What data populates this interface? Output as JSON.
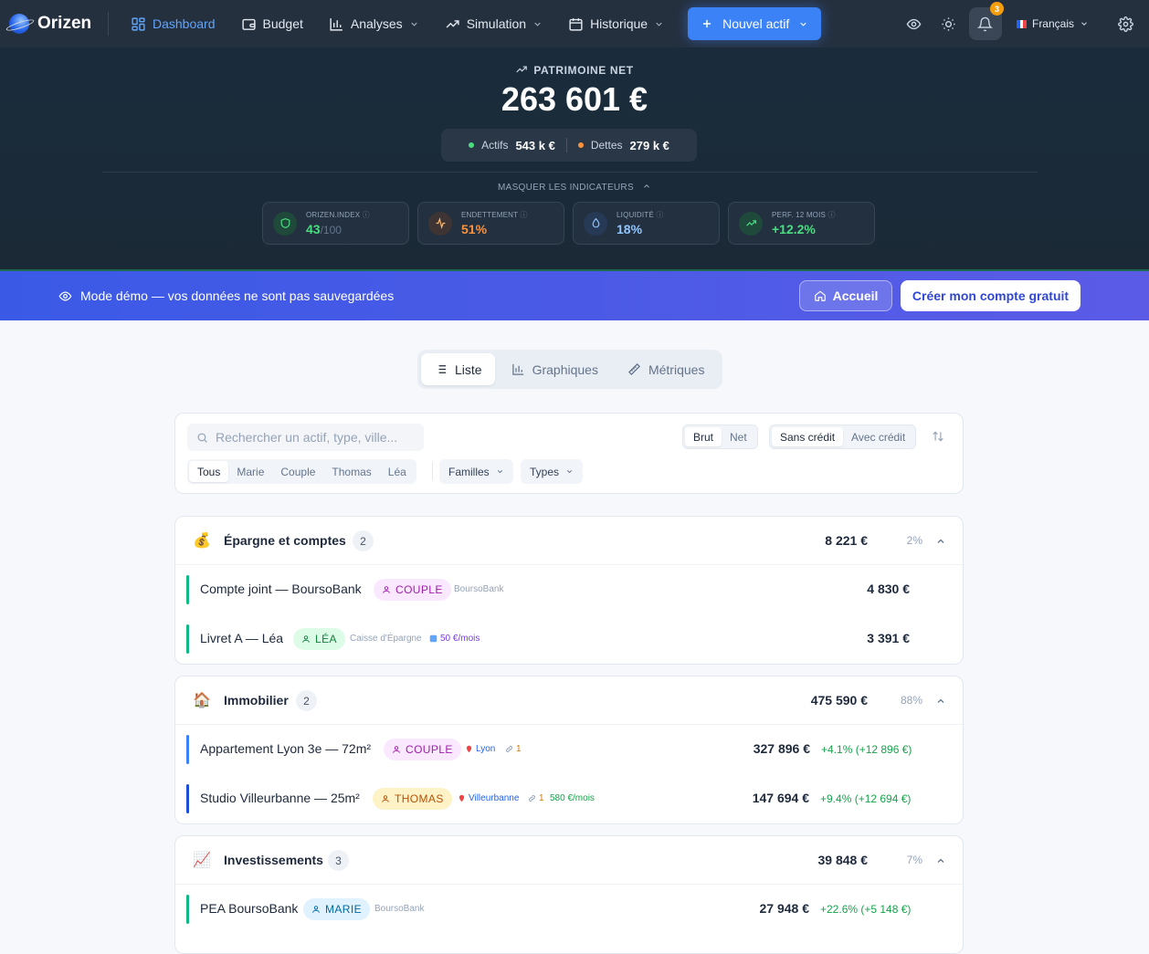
{
  "app": {
    "name": "Orizen"
  },
  "nav": {
    "items": [
      {
        "label": "Dashboard",
        "icon": "dashboard-icon",
        "active": true
      },
      {
        "label": "Budget",
        "icon": "wallet-icon"
      },
      {
        "label": "Analyses",
        "icon": "bar-chart-icon",
        "dropdown": true
      },
      {
        "label": "Simulation",
        "icon": "trending-up-icon",
        "dropdown": true
      },
      {
        "label": "Historique",
        "icon": "calendar-icon",
        "dropdown": true
      }
    ],
    "new_asset_label": "Nouvel actif",
    "notifications_count": "3",
    "language": "Français"
  },
  "hero": {
    "label": "PATRIMOINE NET",
    "net_worth": "263 601 €",
    "assets_label": "Actifs",
    "assets_value": "543 k €",
    "debts_label": "Dettes",
    "debts_value": "279 k €",
    "toggle_label": "MASQUER LES INDICATEURS",
    "kpis": [
      {
        "label": "ORIZEN.INDEX",
        "value": "43",
        "suffix": "/100",
        "color": "#4ade80"
      },
      {
        "label": "ENDETTEMENT",
        "value": "51%",
        "color": "#fb923c"
      },
      {
        "label": "LIQUIDITÉ",
        "value": "18%",
        "color": "#60a5fa"
      },
      {
        "label": "PERF. 12 MOIS",
        "value": "+12.2%",
        "color": "#4ade80"
      }
    ]
  },
  "demo": {
    "message": "Mode démo — vos données ne sont pas sauvegardées",
    "home_label": "Accueil",
    "create_label": "Créer mon compte gratuit"
  },
  "view_tabs": [
    {
      "label": "Liste",
      "active": true
    },
    {
      "label": "Graphiques"
    },
    {
      "label": "Métriques"
    }
  ],
  "filters": {
    "search_placeholder": "Rechercher un actif, type, ville...",
    "value_mode": [
      "Brut",
      "Net"
    ],
    "credit_mode": [
      "Sans crédit",
      "Avec crédit"
    ],
    "people": [
      "Tous",
      "Marie",
      "Couple",
      "Thomas",
      "Léa"
    ],
    "families_label": "Familles",
    "types_label": "Types"
  },
  "groups": [
    {
      "emoji": "💰",
      "title": "Épargne et comptes",
      "count": "2",
      "total": "8 221 €",
      "pct": "2%",
      "rows": [
        {
          "name": "Compte joint — BoursoBank",
          "tag": "COUPLE",
          "bank": "BoursoBank",
          "amount": "4 830 €"
        },
        {
          "name": "Livret A — Léa",
          "tag": "LÉA",
          "bank": "Caisse d'Épargne",
          "extra": "50 €/mois",
          "amount": "3 391 €"
        }
      ]
    },
    {
      "emoji": "🏠",
      "title": "Immobilier",
      "count": "2",
      "total": "475 590 €",
      "pct": "88%",
      "rows": [
        {
          "name": "Appartement Lyon 3e — 72m²",
          "tag": "COUPLE",
          "city": "Lyon",
          "links": "1",
          "amount": "327 896 €",
          "perf": "+4.1% (+12 896 €)"
        },
        {
          "name": "Studio Villeurbanne — 25m²",
          "tag": "THOMAS",
          "city": "Villeurbanne",
          "links": "1",
          "extra": "580 €/mois",
          "amount": "147 694 €",
          "perf": "+9.4% (+12 694 €)"
        }
      ]
    },
    {
      "emoji": "📈",
      "title": "Investissements",
      "count": "3",
      "total": "39 848 €",
      "pct": "7%",
      "rows": [
        {
          "name": "PEA BoursoBank",
          "tag": "MARIE",
          "bank": "BoursoBank",
          "amount": "27 948 €",
          "perf": "+22.6% (+5 148 €)"
        }
      ]
    }
  ]
}
